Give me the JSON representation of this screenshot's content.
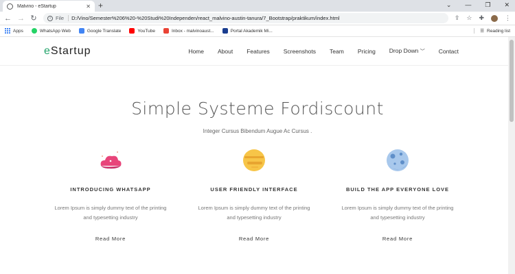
{
  "browser": {
    "tab_title": "Malvino - eStartup",
    "tab_close": "✕",
    "new_tab": "+",
    "url_scheme": "File",
    "url": "D:/Vino/Semester%206%20-%20Studi%20Independen/react_malvino-austin-tanura/7_Bootstrap/praktikum/index.html",
    "bookmarks": [
      {
        "label": "Apps",
        "color": "#4285f4"
      },
      {
        "label": "WhatsApp Web",
        "color": "#25d366"
      },
      {
        "label": "Google Translate",
        "color": "#4285f4"
      },
      {
        "label": "YouTube",
        "color": "#ff0000"
      },
      {
        "label": "Inbox - malvinoaust...",
        "color": "#ea4335"
      },
      {
        "label": "Portal Akademik Mi...",
        "color": "#1a3d8f"
      }
    ],
    "reading_list": "Reading list"
  },
  "site": {
    "logo_prefix": "e",
    "logo_rest": "Startup",
    "menu": [
      "Home",
      "About",
      "Features",
      "Screenshots",
      "Team",
      "Pricing",
      "Drop Down",
      "Contact"
    ],
    "hero_title": "Simple Systeme Fordiscount",
    "hero_subtitle": "Integer Cursus Bibendum Augue Ac Cursus .",
    "features": [
      {
        "title": "INTRODUCING WHATSAPP",
        "line1": "Lorem Ipsum is simply dummy text of the printing",
        "line2": "and typesetting industry",
        "more": "Read More",
        "icon": "cloud-icon"
      },
      {
        "title": "USER FRIENDLY INTERFACE",
        "line1": "Lorem Ipsum is simply dummy text of the printing",
        "line2": "and typesetting industry",
        "more": "Read More",
        "icon": "planet-icon"
      },
      {
        "title": "BUILD THE APP EVERYONE LOVE",
        "line1": "Lorem Ipsum is simply dummy text of the printing",
        "line2": "and typesetting industry",
        "more": "Read More",
        "icon": "moon-icon"
      }
    ]
  },
  "colors": {
    "accent": "#22a36a",
    "chrome_bg": "#dee1e6"
  }
}
